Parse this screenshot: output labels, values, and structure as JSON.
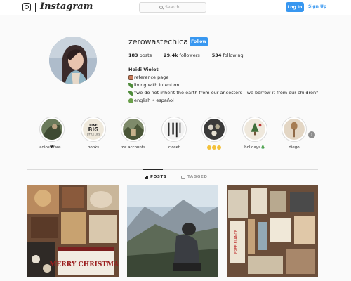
{
  "nav": {
    "wordmark": "Instagram",
    "search_placeholder": "Search",
    "login_label": "Log In",
    "signup_label": "Sign Up"
  },
  "profile": {
    "username": "zerowastechica",
    "follow_label": "Follow",
    "posts_count": "183",
    "posts_label": "posts",
    "followers_count": "29.4k",
    "followers_label": "followers",
    "following_count": "534",
    "following_label": "following",
    "full_name": "Heidi Violet",
    "bio_lines": [
      "reference page",
      "living with intention",
      "\"we do not inherit the earth from our ancestors - we borrow it from our children\"",
      "english • español"
    ]
  },
  "highlights": [
    {
      "label": "adios♥fare..."
    },
    {
      "label": "books"
    },
    {
      "label": "zw accounts"
    },
    {
      "label": "closet"
    },
    {
      "label": ""
    },
    {
      "label": "holidays🎄"
    },
    {
      "label": "diego"
    }
  ],
  "tabs": {
    "posts_label": "POSTS",
    "tagged_label": "TAGGED"
  },
  "posts": [
    {
      "caption_text": "MERRY CHRISTMAS"
    },
    {
      "caption_text": ""
    },
    {
      "caption_text": "FREE-FLANCE"
    }
  ],
  "icons": {
    "instagram_logo": "instagram-glyph-icon",
    "search": "search-icon",
    "posts_tab": "grid-icon",
    "tagged_tab": "tag-icon",
    "next": "chevron-right-icon"
  },
  "colors": {
    "accent": "#3897f0",
    "text": "#262626",
    "muted": "#999999",
    "border": "#dbdbdb",
    "background": "#fafafa"
  }
}
